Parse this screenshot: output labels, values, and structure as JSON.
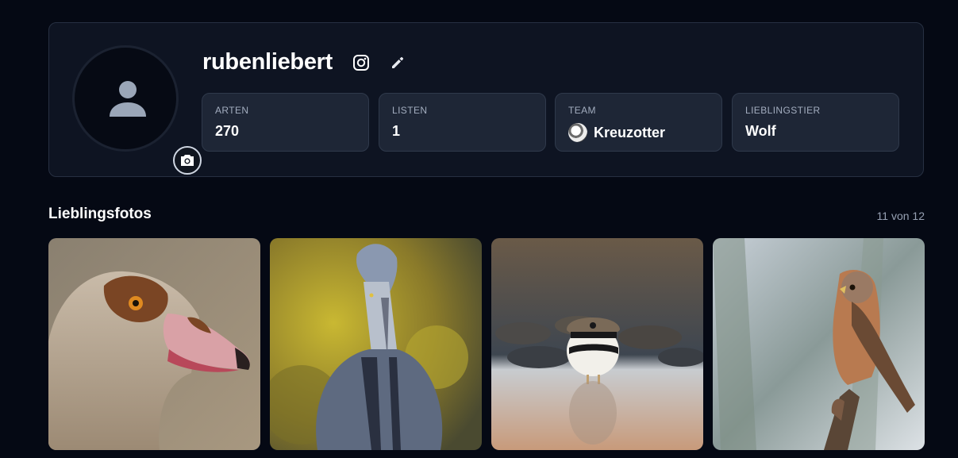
{
  "profile": {
    "username": "rubenliebert",
    "avatar_icon": "person-icon",
    "camera_icon": "camera-icon",
    "instagram_icon": "instagram-icon",
    "edit_icon": "pencil-icon"
  },
  "stats": [
    {
      "label": "ARTEN",
      "value": "270"
    },
    {
      "label": "LISTEN",
      "value": "1"
    },
    {
      "label": "TEAM",
      "value": "Kreuzotter",
      "icon": "snake-team-badge-icon"
    },
    {
      "label": "LIEBLINGSTIER",
      "value": "Wolf"
    }
  ],
  "favorites": {
    "title": "Lieblingsfotos",
    "count_text": "11 von 12",
    "photos": [
      "egyptian-goose-photo",
      "grey-heron-photo",
      "little-ringed-plover-photo",
      "kestrel-photo"
    ]
  },
  "colors": {
    "background": "#050914",
    "card": "#0e1422",
    "stat_box": "#1e2636",
    "text": "#ffffff",
    "muted": "#a3adbf"
  }
}
